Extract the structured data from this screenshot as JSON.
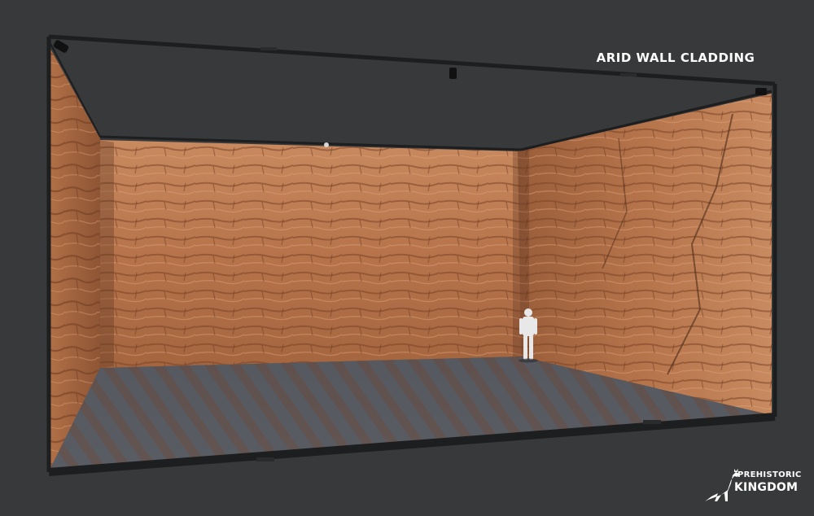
{
  "heading": {
    "title": "ARID WALL CLADDING"
  },
  "brand": {
    "logo_line1": "PREHISTORIC",
    "logo_line2": "KINGDOM",
    "logo_icon": "dinosaur-icon"
  },
  "colors": {
    "background": "#38393a",
    "rock": "#b8714a",
    "frame": "#1e1f20",
    "floor": "#5a5d63"
  }
}
